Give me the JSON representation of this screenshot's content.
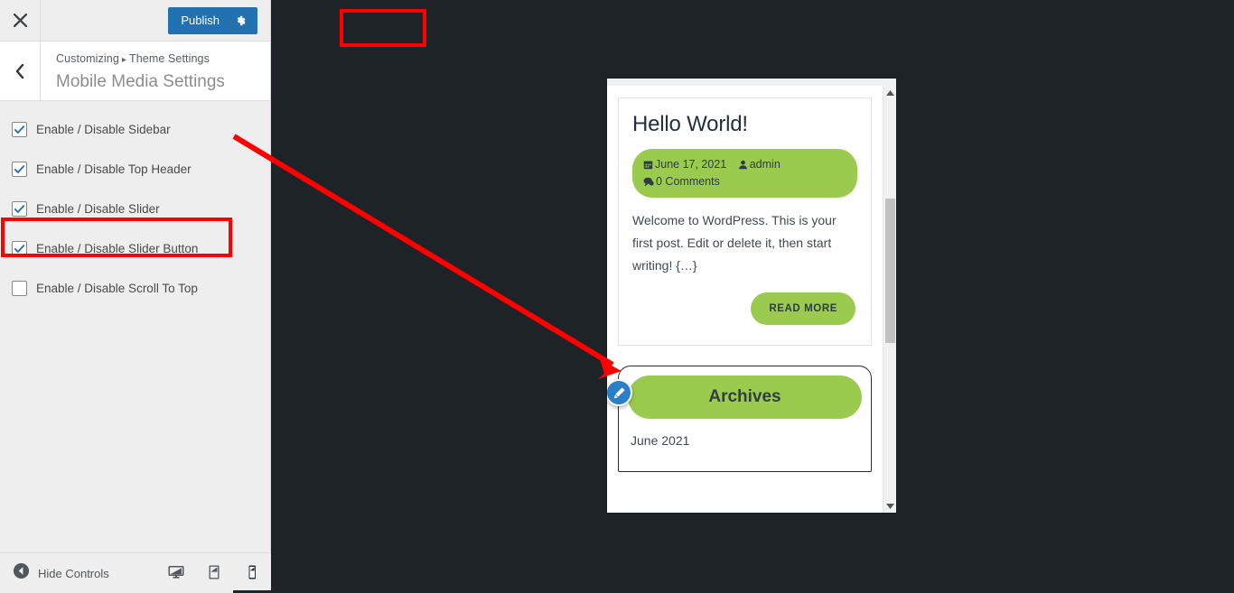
{
  "customizer": {
    "close_icon": "close-x-icon",
    "publish": {
      "label": "Publish",
      "icon": "gear-icon",
      "color": "#2271b1"
    },
    "back_icon": "chevron-left-icon",
    "breadcrumb": {
      "root": "Customizing",
      "separator": "▸",
      "parent": "Theme Settings"
    },
    "section_title": "Mobile Media Settings",
    "controls": [
      {
        "label": "Enable / Disable Sidebar",
        "checked": true
      },
      {
        "label": "Enable / Disable Top Header",
        "checked": true
      },
      {
        "label": "Enable / Disable Slider",
        "checked": true
      },
      {
        "label": "Enable / Disable Slider Button",
        "checked": true
      },
      {
        "label": "Enable / Disable Scroll To Top",
        "checked": false
      }
    ],
    "footer": {
      "hide_controls_label": "Hide Controls",
      "hide_controls_icon": "collapse-left-icon",
      "devices": [
        {
          "name": "desktop",
          "icon": "desktop-icon",
          "active": false
        },
        {
          "name": "tablet",
          "icon": "tablet-icon",
          "active": false
        },
        {
          "name": "mobile",
          "icon": "mobile-icon",
          "active": true
        }
      ]
    }
  },
  "preview": {
    "post": {
      "title": "Hello World!",
      "meta": {
        "date_icon": "calendar-icon",
        "date": "June 17, 2021",
        "author_icon": "user-icon",
        "author": "admin",
        "comments_icon": "comment-icon",
        "comments": "0 Comments"
      },
      "excerpt": "Welcome to WordPress. This is your first post. Edit or delete it, then start writing! {…}",
      "read_more": "READ MORE"
    },
    "widget": {
      "edit_icon": "pencil-edit-icon",
      "title": "Archives",
      "items": [
        "June 2021"
      ]
    },
    "scrollbar": {
      "up_icon": "triangle-up-icon",
      "down_icon": "triangle-down-icon"
    }
  },
  "annotations": {
    "highlight_color": "#ff0000",
    "boxes": [
      "publish-button",
      "enable-disable-sidebar-row"
    ],
    "arrow": "sidebar-row-to-archives-widget"
  },
  "theme_colors": {
    "accent_green": "#9ACB4E",
    "wp_blue": "#2271b1",
    "canvas_dark": "#1e2327"
  }
}
